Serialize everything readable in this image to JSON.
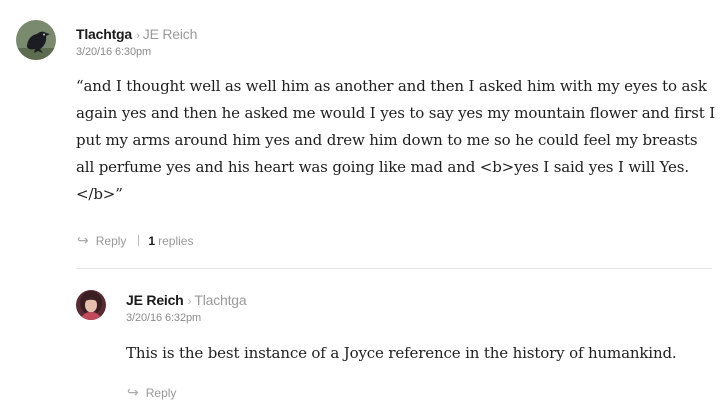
{
  "comments": [
    {
      "author": "Tlachtga",
      "reply_to": "JE Reich",
      "timestamp": "3/20/16 6:30pm",
      "body": "“and I thought well as well him as another and then I asked him with my eyes to ask again yes and then he asked me would I yes to say yes my mountain flower and first I put my arms around him yes and drew him down to me so he could feel my breasts all perfume yes and his heart was going like mad and <b>yes I said yes I will Yes.</b>”",
      "reply_label": "Reply",
      "replies_count": "1",
      "replies_label": "replies"
    },
    {
      "author": "JE Reich",
      "reply_to": "Tlachtga",
      "timestamp": "3/20/16 6:32pm",
      "body": "This is the best instance of a Joyce reference in the history of humankind.",
      "reply_label": "Reply"
    }
  ],
  "icons": {
    "arrow": "›",
    "reply": "↪"
  }
}
